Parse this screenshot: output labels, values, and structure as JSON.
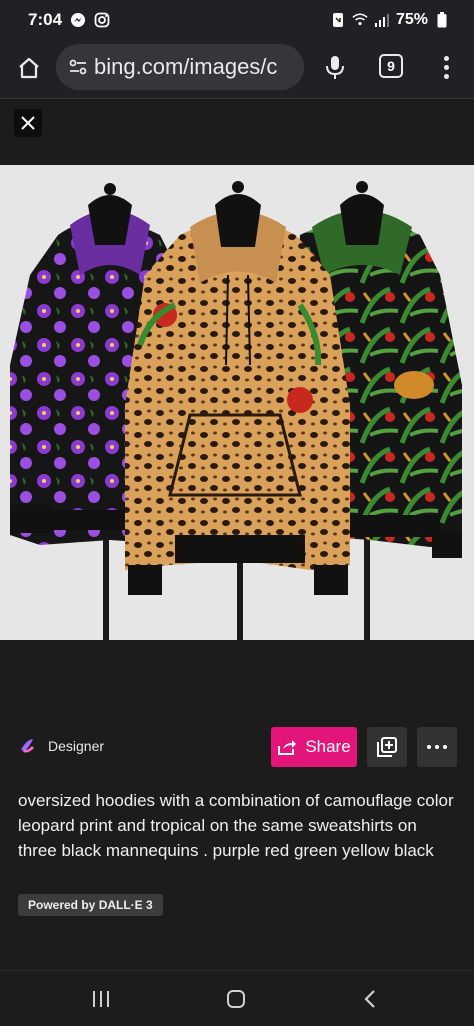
{
  "status": {
    "time": "7:04",
    "battery": "75%"
  },
  "browser": {
    "url": "bing.com/images/c",
    "tab_count": "9"
  },
  "result": {
    "source_label": "Designer",
    "share_label": "Share",
    "caption": "oversized hoodies with a combination of camouflage color leopard print and tropical on the same sweatshirts on three black mannequins . purple red green yellow black",
    "badge": "Powered by DALL·E 3"
  },
  "colors": {
    "share_accent": "#e3157b",
    "page_bg": "#1c1c1c",
    "image_bg": "#e5e5e5"
  },
  "icons": {
    "status": [
      "messenger-icon",
      "instagram-icon",
      "wifi-icon",
      "signal-icon",
      "battery-icon"
    ],
    "toolbar": [
      "home-icon",
      "tune-icon",
      "mic-icon",
      "tabs-icon",
      "menu-icon"
    ],
    "actions": [
      "close-icon",
      "share-icon",
      "collection-add-icon",
      "more-icon"
    ],
    "nav": [
      "recents-icon",
      "home-nav-icon",
      "back-icon"
    ]
  }
}
